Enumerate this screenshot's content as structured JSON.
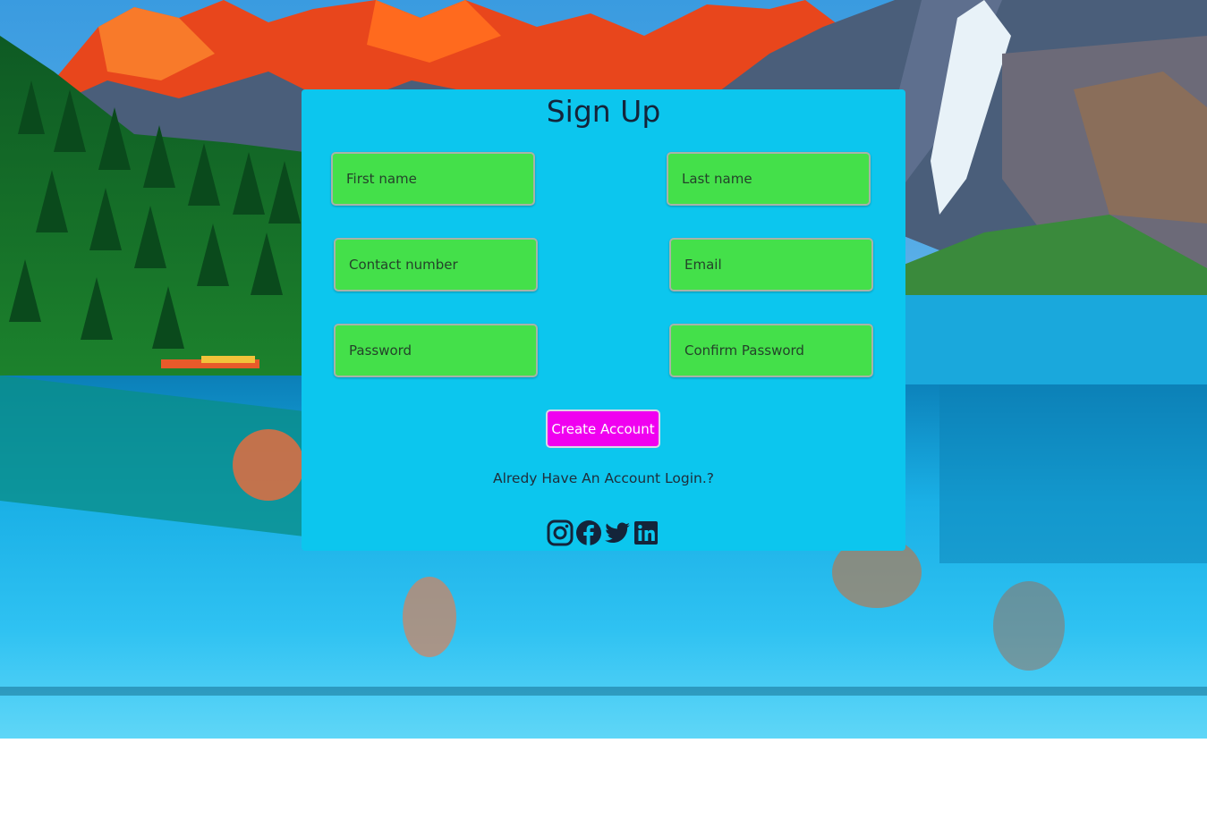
{
  "page": {
    "title": "Sign Up"
  },
  "form": {
    "first_name_placeholder": "First name",
    "last_name_placeholder": "Last name",
    "contact_placeholder": "Contact number",
    "email_placeholder": "Email",
    "password_placeholder": "Password",
    "confirm_password_placeholder": "Confirm Password",
    "submit_label": "Create Account",
    "login_link": "Alredy Have An Account Login.?"
  },
  "social": [
    "instagram-icon",
    "facebook-icon",
    "twitter-icon",
    "linkedin-icon"
  ],
  "colors": {
    "card": "#0cc6ee",
    "field": "#44e04a",
    "button": "#f000f0",
    "text": "#14243a"
  }
}
